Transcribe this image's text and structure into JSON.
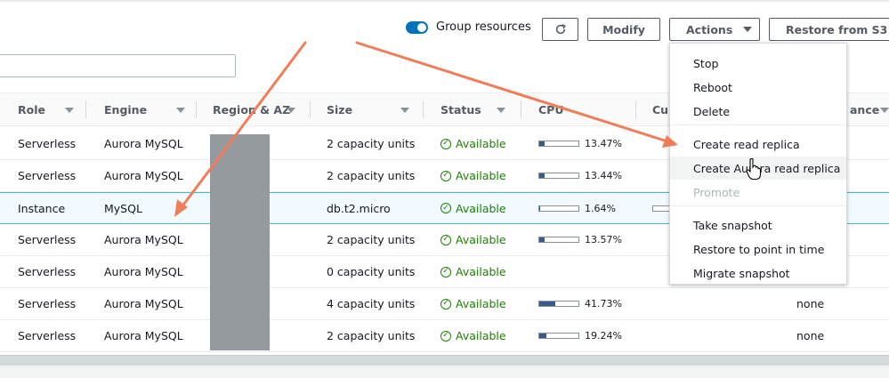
{
  "toolbar": {
    "group_resources_label": "Group resources",
    "refresh_icon": "refresh-icon",
    "modify_label": "Modify",
    "actions_label": "Actions",
    "restore_label": "Restore from S3"
  },
  "table": {
    "columns": [
      "Role",
      "Engine",
      "Region & AZ",
      "Size",
      "Status",
      "CPU",
      "Cur",
      "ance"
    ],
    "rows": [
      {
        "role": "Serverless",
        "engine": "Aurora MySQL",
        "size": "2 capacity units",
        "status": "Available",
        "cpu": "13.47%",
        "cpu_value": 13.47,
        "extra": ""
      },
      {
        "role": "Serverless",
        "engine": "Aurora MySQL",
        "size": "2 capacity units",
        "status": "Available",
        "cpu": "13.44%",
        "cpu_value": 13.44,
        "extra": ""
      },
      {
        "role": "Instance",
        "engine": "MySQL",
        "size": "db.t2.micro",
        "status": "Available",
        "cpu": "1.64%",
        "cpu_value": 1.64,
        "extra": ""
      },
      {
        "role": "Serverless",
        "engine": "Aurora MySQL",
        "size": "2 capacity units",
        "status": "Available",
        "cpu": "13.57%",
        "cpu_value": 13.57,
        "extra": ""
      },
      {
        "role": "Serverless",
        "engine": "Aurora MySQL",
        "size": "0 capacity units",
        "status": "Available",
        "cpu": "",
        "cpu_value": null,
        "extra": ""
      },
      {
        "role": "Serverless",
        "engine": "Aurora MySQL",
        "size": "4 capacity units",
        "status": "Available",
        "cpu": "41.73%",
        "cpu_value": 41.73,
        "extra": "none"
      },
      {
        "role": "Serverless",
        "engine": "Aurora MySQL",
        "size": "2 capacity units",
        "status": "Available",
        "cpu": "19.24%",
        "cpu_value": 19.24,
        "extra": "none"
      }
    ]
  },
  "actions_menu": {
    "items": [
      "Stop",
      "Reboot",
      "Delete",
      "Create read replica",
      "Create Aurora read replica",
      "Promote",
      "Take snapshot",
      "Restore to point in time",
      "Migrate snapshot"
    ],
    "hovered": "Create Aurora read replica",
    "disabled": [
      "Promote"
    ]
  },
  "colors": {
    "accent": "#0073bb",
    "available_green": "#1d8102",
    "annotation_arrow": "#ef7d5a"
  }
}
